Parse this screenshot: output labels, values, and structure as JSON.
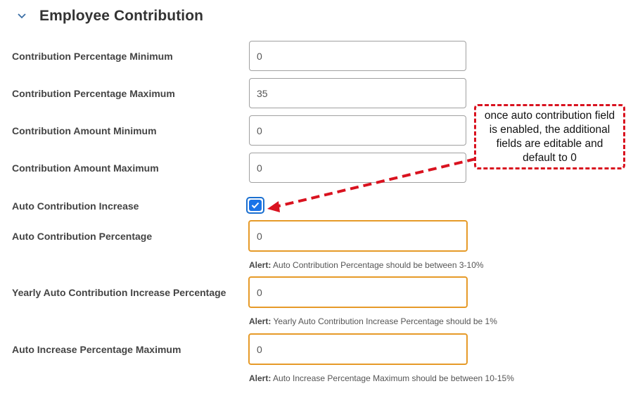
{
  "section": {
    "title": "Employee Contribution",
    "expanded": true
  },
  "fields": [
    {
      "label": "Contribution Percentage Minimum",
      "value": "0"
    },
    {
      "label": "Contribution Percentage Maximum",
      "value": "35"
    },
    {
      "label": "Contribution Amount Minimum",
      "value": "0"
    },
    {
      "label": "Contribution Amount Maximum",
      "value": "0"
    }
  ],
  "auto_contribution": {
    "label": "Auto Contribution Increase",
    "checked": true
  },
  "warn_fields": [
    {
      "label": "Auto Contribution Percentage",
      "value": "0",
      "alert_prefix": "Alert:",
      "alert_text": " Auto Contribution Percentage should be between 3-10%"
    },
    {
      "label": "Yearly Auto Contribution Increase Percentage",
      "value": "0",
      "alert_prefix": "Alert:",
      "alert_text": " Yearly Auto Contribution Increase Percentage should be 1%"
    },
    {
      "label": "Auto Increase Percentage Maximum",
      "value": "0",
      "alert_prefix": "Alert:",
      "alert_text": " Auto Increase Percentage Maximum should be between 10-15%"
    }
  ],
  "annotation": {
    "text": "once auto contribution field is enabled, the additional fields are editable and default to 0"
  },
  "colors": {
    "warning_border": "#e69a28",
    "checkbox_blue": "#1a73e8",
    "annotation_red": "#d9121f"
  }
}
